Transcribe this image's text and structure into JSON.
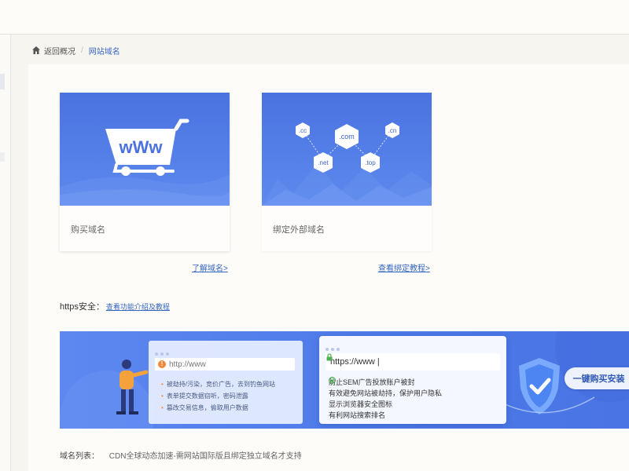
{
  "breadcrumb": {
    "back_label": "返回概况",
    "separator": "/",
    "current_label": "网站域名"
  },
  "cards": {
    "buy": {
      "label": "购买域名",
      "banner_text": "wWw"
    },
    "bind": {
      "label": "绑定外部域名",
      "tlds": [
        ".cc",
        ".com",
        ".cn",
        ".net",
        ".top"
      ]
    }
  },
  "links": {
    "learn_domain": "了解域名>",
    "bind_tutorial": "查看绑定教程>"
  },
  "https_section": {
    "label": "https安全：",
    "link": "查看功能介绍及教程"
  },
  "promo": {
    "bad_url": "http://www",
    "bad_points": [
      "被劫持/污染，竞价广告，去到钓鱼网站",
      "表单提交数据窃听，密码泄露",
      "篡改交易信息，偷取用户数据"
    ],
    "good_url": "https://www",
    "good_points": [
      "防止SEM广告投放账户被封",
      "有效避免网站被劫持，保护用户隐私",
      "显示浏览器安全图标",
      "有利网站搜索排名"
    ],
    "buy_button_label": "一键购买安装",
    "buy_button_arrow": "›"
  },
  "domain_list": {
    "label": "域名列表：",
    "note": "CDN全球动态加速-需网站国际版且绑定独立域名才支持"
  },
  "colors": {
    "banner_blue": "#4a72e0",
    "link_blue": "#3566c0",
    "warn_orange": "#f08a3a",
    "safe_green": "#4cb050"
  }
}
